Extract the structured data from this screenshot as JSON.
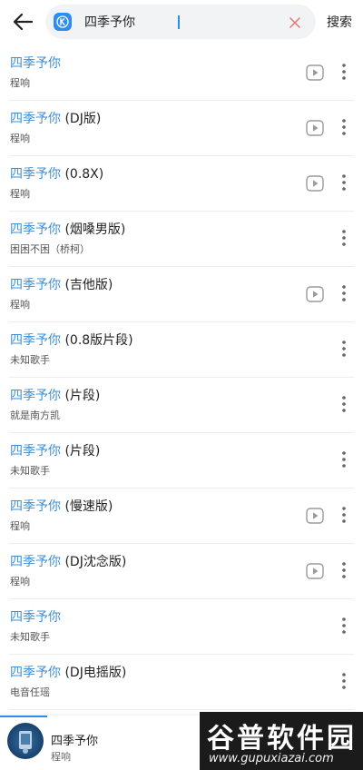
{
  "search": {
    "query": "四季予你",
    "submit_label": "搜索"
  },
  "results": [
    {
      "title_highlight": "四季予你",
      "title_suffix": "",
      "artist": "程响",
      "has_mv": true
    },
    {
      "title_highlight": "四季予你",
      "title_suffix": " (DJ版)",
      "artist": "程响",
      "has_mv": true
    },
    {
      "title_highlight": "四季予你",
      "title_suffix": " (0.8X)",
      "artist": "程响",
      "has_mv": true
    },
    {
      "title_highlight": "四季予你",
      "title_suffix": " (烟嗓男版)",
      "artist": "困困不困（桥柯）",
      "has_mv": false
    },
    {
      "title_highlight": "四季予你",
      "title_suffix": " (吉他版)",
      "artist": "程响",
      "has_mv": true
    },
    {
      "title_highlight": "四季予你",
      "title_suffix": " (0.8版片段)",
      "artist": "未知歌手",
      "has_mv": false
    },
    {
      "title_highlight": "四季予你",
      "title_suffix": " (片段)",
      "artist": "就是南方凯",
      "has_mv": false
    },
    {
      "title_highlight": "四季予你",
      "title_suffix": " (片段)",
      "artist": "未知歌手",
      "has_mv": false
    },
    {
      "title_highlight": "四季予你",
      "title_suffix": " (慢速版)",
      "artist": "程响",
      "has_mv": true
    },
    {
      "title_highlight": "四季予你",
      "title_suffix": " (DJ沈念版)",
      "artist": "程响",
      "has_mv": true
    },
    {
      "title_highlight": "四季予你",
      "title_suffix": "",
      "artist": "未知歌手",
      "has_mv": false
    },
    {
      "title_highlight": "四季予你",
      "title_suffix": " (DJ电摇版)",
      "artist": "电音任瑶",
      "has_mv": false
    }
  ],
  "now_playing": {
    "title": "四季予你",
    "artist": "程响",
    "progress": 0.13
  },
  "watermark": {
    "main": "谷普软件园",
    "sub": "www.gupuxiazai.com"
  },
  "colors": {
    "accent": "#2d8cf0",
    "highlight": "#3e8fd6",
    "clear_x": "#e8736c"
  },
  "icons": {
    "back": "arrow-left-icon",
    "app_logo": "kugou-k-logo-icon",
    "clear": "close-icon",
    "mv": "play-video-icon",
    "more": "more-vertical-icon"
  }
}
